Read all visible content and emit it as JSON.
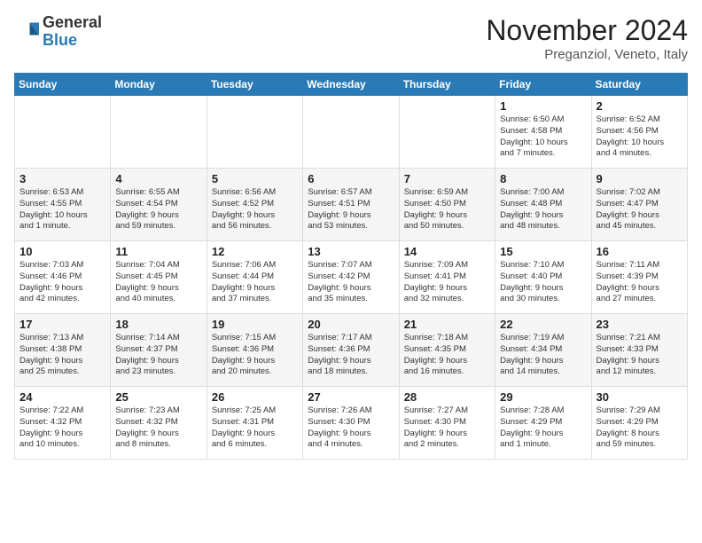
{
  "header": {
    "logo": {
      "general": "General",
      "blue": "Blue"
    },
    "title": "November 2024",
    "location": "Preganziol, Veneto, Italy"
  },
  "calendar": {
    "days_of_week": [
      "Sunday",
      "Monday",
      "Tuesday",
      "Wednesday",
      "Thursday",
      "Friday",
      "Saturday"
    ],
    "weeks": [
      [
        {
          "day": "",
          "detail": ""
        },
        {
          "day": "",
          "detail": ""
        },
        {
          "day": "",
          "detail": ""
        },
        {
          "day": "",
          "detail": ""
        },
        {
          "day": "",
          "detail": ""
        },
        {
          "day": "1",
          "detail": "Sunrise: 6:50 AM\nSunset: 4:58 PM\nDaylight: 10 hours\nand 7 minutes."
        },
        {
          "day": "2",
          "detail": "Sunrise: 6:52 AM\nSunset: 4:56 PM\nDaylight: 10 hours\nand 4 minutes."
        }
      ],
      [
        {
          "day": "3",
          "detail": "Sunrise: 6:53 AM\nSunset: 4:55 PM\nDaylight: 10 hours\nand 1 minute."
        },
        {
          "day": "4",
          "detail": "Sunrise: 6:55 AM\nSunset: 4:54 PM\nDaylight: 9 hours\nand 59 minutes."
        },
        {
          "day": "5",
          "detail": "Sunrise: 6:56 AM\nSunset: 4:52 PM\nDaylight: 9 hours\nand 56 minutes."
        },
        {
          "day": "6",
          "detail": "Sunrise: 6:57 AM\nSunset: 4:51 PM\nDaylight: 9 hours\nand 53 minutes."
        },
        {
          "day": "7",
          "detail": "Sunrise: 6:59 AM\nSunset: 4:50 PM\nDaylight: 9 hours\nand 50 minutes."
        },
        {
          "day": "8",
          "detail": "Sunrise: 7:00 AM\nSunset: 4:48 PM\nDaylight: 9 hours\nand 48 minutes."
        },
        {
          "day": "9",
          "detail": "Sunrise: 7:02 AM\nSunset: 4:47 PM\nDaylight: 9 hours\nand 45 minutes."
        }
      ],
      [
        {
          "day": "10",
          "detail": "Sunrise: 7:03 AM\nSunset: 4:46 PM\nDaylight: 9 hours\nand 42 minutes."
        },
        {
          "day": "11",
          "detail": "Sunrise: 7:04 AM\nSunset: 4:45 PM\nDaylight: 9 hours\nand 40 minutes."
        },
        {
          "day": "12",
          "detail": "Sunrise: 7:06 AM\nSunset: 4:44 PM\nDaylight: 9 hours\nand 37 minutes."
        },
        {
          "day": "13",
          "detail": "Sunrise: 7:07 AM\nSunset: 4:42 PM\nDaylight: 9 hours\nand 35 minutes."
        },
        {
          "day": "14",
          "detail": "Sunrise: 7:09 AM\nSunset: 4:41 PM\nDaylight: 9 hours\nand 32 minutes."
        },
        {
          "day": "15",
          "detail": "Sunrise: 7:10 AM\nSunset: 4:40 PM\nDaylight: 9 hours\nand 30 minutes."
        },
        {
          "day": "16",
          "detail": "Sunrise: 7:11 AM\nSunset: 4:39 PM\nDaylight: 9 hours\nand 27 minutes."
        }
      ],
      [
        {
          "day": "17",
          "detail": "Sunrise: 7:13 AM\nSunset: 4:38 PM\nDaylight: 9 hours\nand 25 minutes."
        },
        {
          "day": "18",
          "detail": "Sunrise: 7:14 AM\nSunset: 4:37 PM\nDaylight: 9 hours\nand 23 minutes."
        },
        {
          "day": "19",
          "detail": "Sunrise: 7:15 AM\nSunset: 4:36 PM\nDaylight: 9 hours\nand 20 minutes."
        },
        {
          "day": "20",
          "detail": "Sunrise: 7:17 AM\nSunset: 4:36 PM\nDaylight: 9 hours\nand 18 minutes."
        },
        {
          "day": "21",
          "detail": "Sunrise: 7:18 AM\nSunset: 4:35 PM\nDaylight: 9 hours\nand 16 minutes."
        },
        {
          "day": "22",
          "detail": "Sunrise: 7:19 AM\nSunset: 4:34 PM\nDaylight: 9 hours\nand 14 minutes."
        },
        {
          "day": "23",
          "detail": "Sunrise: 7:21 AM\nSunset: 4:33 PM\nDaylight: 9 hours\nand 12 minutes."
        }
      ],
      [
        {
          "day": "24",
          "detail": "Sunrise: 7:22 AM\nSunset: 4:32 PM\nDaylight: 9 hours\nand 10 minutes."
        },
        {
          "day": "25",
          "detail": "Sunrise: 7:23 AM\nSunset: 4:32 PM\nDaylight: 9 hours\nand 8 minutes."
        },
        {
          "day": "26",
          "detail": "Sunrise: 7:25 AM\nSunset: 4:31 PM\nDaylight: 9 hours\nand 6 minutes."
        },
        {
          "day": "27",
          "detail": "Sunrise: 7:26 AM\nSunset: 4:30 PM\nDaylight: 9 hours\nand 4 minutes."
        },
        {
          "day": "28",
          "detail": "Sunrise: 7:27 AM\nSunset: 4:30 PM\nDaylight: 9 hours\nand 2 minutes."
        },
        {
          "day": "29",
          "detail": "Sunrise: 7:28 AM\nSunset: 4:29 PM\nDaylight: 9 hours\nand 1 minute."
        },
        {
          "day": "30",
          "detail": "Sunrise: 7:29 AM\nSunset: 4:29 PM\nDaylight: 8 hours\nand 59 minutes."
        }
      ]
    ]
  }
}
